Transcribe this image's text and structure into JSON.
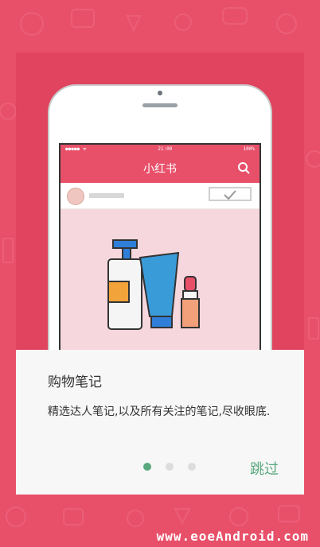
{
  "app_title": "小红书",
  "status_bar": {
    "time": "21:00",
    "battery": "100%"
  },
  "card": {
    "heading": "购物笔记",
    "description": "精选达人笔记,以及所有关注的笔记,尽收眼底.",
    "skip_label": "跳过",
    "page_count": 3,
    "active_page": 1
  },
  "watermark": "www.eoeAndroid.com",
  "colors": {
    "background": "#e8506a",
    "accent_green": "#5aa87e",
    "card_bg": "#f7f7f7"
  },
  "icons": {
    "search": "search-icon",
    "check": "check-icon",
    "avatar": "avatar-icon"
  }
}
